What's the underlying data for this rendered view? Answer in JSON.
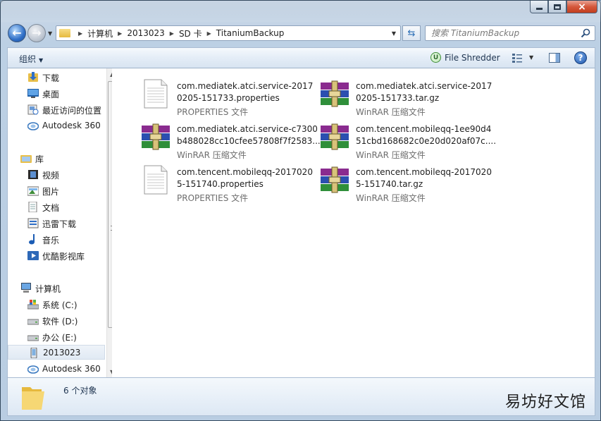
{
  "window": {
    "caption": {
      "close_glyph": "×"
    }
  },
  "nav": {
    "back_glyph": "←",
    "forward_glyph": "→"
  },
  "address": {
    "crumbs": [
      "计算机",
      "2013023",
      "SD 卡",
      "TitaniumBackup"
    ]
  },
  "search": {
    "placeholder": "搜索 TitaniumBackup"
  },
  "toolbar": {
    "organize_label": "组织",
    "file_shredder_label": "File Shredder",
    "help_glyph": "?"
  },
  "sidebar": {
    "favorites": [
      {
        "label": "下载",
        "icon": "download-folder-icon"
      },
      {
        "label": "桌面",
        "icon": "desktop-icon"
      },
      {
        "label": "最近访问的位置",
        "icon": "recent-places-icon"
      },
      {
        "label": "Autodesk 360",
        "icon": "autodesk-cloud-icon"
      }
    ],
    "libraries_label": "库",
    "libraries": [
      {
        "label": "视频",
        "icon": "video-library-icon"
      },
      {
        "label": "图片",
        "icon": "pictures-library-icon"
      },
      {
        "label": "文档",
        "icon": "documents-library-icon"
      },
      {
        "label": "迅雷下载",
        "icon": "thunder-download-icon"
      },
      {
        "label": "音乐",
        "icon": "music-library-icon"
      },
      {
        "label": "优酷影视库",
        "icon": "youku-library-icon"
      }
    ],
    "computer_label": "计算机",
    "drives": [
      {
        "label": "系统 (C:)",
        "icon": "system-drive-icon"
      },
      {
        "label": "软件 (D:)",
        "icon": "drive-icon"
      },
      {
        "label": "办公 (E:)",
        "icon": "drive-icon"
      },
      {
        "label": "2013023",
        "icon": "phone-device-icon",
        "selected": true
      },
      {
        "label": "Autodesk 360",
        "icon": "autodesk-cloud-icon"
      }
    ]
  },
  "files": [
    {
      "line1": "com.mediatek.atci.service-2017",
      "line2": "0205-151733.properties",
      "type": "PROPERTIES 文件",
      "kind": "properties"
    },
    {
      "line1": "com.mediatek.atci.service-2017",
      "line2": "0205-151733.tar.gz",
      "type": "WinRAR 压缩文件",
      "kind": "archive"
    },
    {
      "line1": "com.mediatek.atci.service-c7300",
      "line2": "b488028cc10cfee57808f7f2583...",
      "type": "WinRAR 压缩文件",
      "kind": "archive"
    },
    {
      "line1": "com.tencent.mobileqq-1ee90d4",
      "line2": "51cbd168682c0e20d020af07c....",
      "type": "WinRAR 压缩文件",
      "kind": "archive"
    },
    {
      "line1": "com.tencent.mobileqq-2017020",
      "line2": "5-151740.properties",
      "type": "PROPERTIES 文件",
      "kind": "properties"
    },
    {
      "line1": "com.tencent.mobileqq-2017020",
      "line2": "5-151740.tar.gz",
      "type": "WinRAR 压缩文件",
      "kind": "archive"
    }
  ],
  "status": {
    "count_text": "6 个对象"
  },
  "watermark": "易坊好文馆"
}
